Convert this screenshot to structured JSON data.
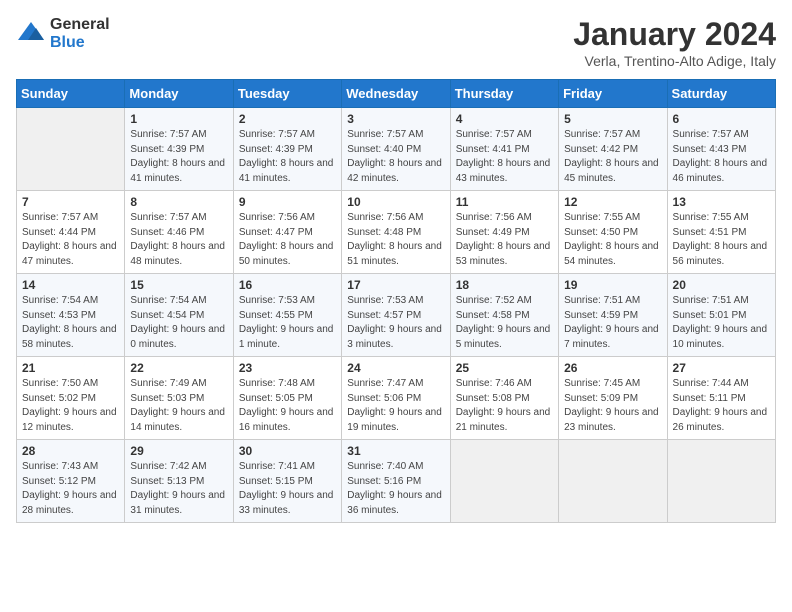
{
  "header": {
    "logo_line1": "General",
    "logo_line2": "Blue",
    "month": "January 2024",
    "location": "Verla, Trentino-Alto Adige, Italy"
  },
  "days_of_week": [
    "Sunday",
    "Monday",
    "Tuesday",
    "Wednesday",
    "Thursday",
    "Friday",
    "Saturday"
  ],
  "weeks": [
    [
      {
        "num": "",
        "sunrise": "",
        "sunset": "",
        "daylight": ""
      },
      {
        "num": "1",
        "sunrise": "Sunrise: 7:57 AM",
        "sunset": "Sunset: 4:39 PM",
        "daylight": "Daylight: 8 hours and 41 minutes."
      },
      {
        "num": "2",
        "sunrise": "Sunrise: 7:57 AM",
        "sunset": "Sunset: 4:39 PM",
        "daylight": "Daylight: 8 hours and 41 minutes."
      },
      {
        "num": "3",
        "sunrise": "Sunrise: 7:57 AM",
        "sunset": "Sunset: 4:40 PM",
        "daylight": "Daylight: 8 hours and 42 minutes."
      },
      {
        "num": "4",
        "sunrise": "Sunrise: 7:57 AM",
        "sunset": "Sunset: 4:41 PM",
        "daylight": "Daylight: 8 hours and 43 minutes."
      },
      {
        "num": "5",
        "sunrise": "Sunrise: 7:57 AM",
        "sunset": "Sunset: 4:42 PM",
        "daylight": "Daylight: 8 hours and 45 minutes."
      },
      {
        "num": "6",
        "sunrise": "Sunrise: 7:57 AM",
        "sunset": "Sunset: 4:43 PM",
        "daylight": "Daylight: 8 hours and 46 minutes."
      }
    ],
    [
      {
        "num": "7",
        "sunrise": "Sunrise: 7:57 AM",
        "sunset": "Sunset: 4:44 PM",
        "daylight": "Daylight: 8 hours and 47 minutes."
      },
      {
        "num": "8",
        "sunrise": "Sunrise: 7:57 AM",
        "sunset": "Sunset: 4:46 PM",
        "daylight": "Daylight: 8 hours and 48 minutes."
      },
      {
        "num": "9",
        "sunrise": "Sunrise: 7:56 AM",
        "sunset": "Sunset: 4:47 PM",
        "daylight": "Daylight: 8 hours and 50 minutes."
      },
      {
        "num": "10",
        "sunrise": "Sunrise: 7:56 AM",
        "sunset": "Sunset: 4:48 PM",
        "daylight": "Daylight: 8 hours and 51 minutes."
      },
      {
        "num": "11",
        "sunrise": "Sunrise: 7:56 AM",
        "sunset": "Sunset: 4:49 PM",
        "daylight": "Daylight: 8 hours and 53 minutes."
      },
      {
        "num": "12",
        "sunrise": "Sunrise: 7:55 AM",
        "sunset": "Sunset: 4:50 PM",
        "daylight": "Daylight: 8 hours and 54 minutes."
      },
      {
        "num": "13",
        "sunrise": "Sunrise: 7:55 AM",
        "sunset": "Sunset: 4:51 PM",
        "daylight": "Daylight: 8 hours and 56 minutes."
      }
    ],
    [
      {
        "num": "14",
        "sunrise": "Sunrise: 7:54 AM",
        "sunset": "Sunset: 4:53 PM",
        "daylight": "Daylight: 8 hours and 58 minutes."
      },
      {
        "num": "15",
        "sunrise": "Sunrise: 7:54 AM",
        "sunset": "Sunset: 4:54 PM",
        "daylight": "Daylight: 9 hours and 0 minutes."
      },
      {
        "num": "16",
        "sunrise": "Sunrise: 7:53 AM",
        "sunset": "Sunset: 4:55 PM",
        "daylight": "Daylight: 9 hours and 1 minute."
      },
      {
        "num": "17",
        "sunrise": "Sunrise: 7:53 AM",
        "sunset": "Sunset: 4:57 PM",
        "daylight": "Daylight: 9 hours and 3 minutes."
      },
      {
        "num": "18",
        "sunrise": "Sunrise: 7:52 AM",
        "sunset": "Sunset: 4:58 PM",
        "daylight": "Daylight: 9 hours and 5 minutes."
      },
      {
        "num": "19",
        "sunrise": "Sunrise: 7:51 AM",
        "sunset": "Sunset: 4:59 PM",
        "daylight": "Daylight: 9 hours and 7 minutes."
      },
      {
        "num": "20",
        "sunrise": "Sunrise: 7:51 AM",
        "sunset": "Sunset: 5:01 PM",
        "daylight": "Daylight: 9 hours and 10 minutes."
      }
    ],
    [
      {
        "num": "21",
        "sunrise": "Sunrise: 7:50 AM",
        "sunset": "Sunset: 5:02 PM",
        "daylight": "Daylight: 9 hours and 12 minutes."
      },
      {
        "num": "22",
        "sunrise": "Sunrise: 7:49 AM",
        "sunset": "Sunset: 5:03 PM",
        "daylight": "Daylight: 9 hours and 14 minutes."
      },
      {
        "num": "23",
        "sunrise": "Sunrise: 7:48 AM",
        "sunset": "Sunset: 5:05 PM",
        "daylight": "Daylight: 9 hours and 16 minutes."
      },
      {
        "num": "24",
        "sunrise": "Sunrise: 7:47 AM",
        "sunset": "Sunset: 5:06 PM",
        "daylight": "Daylight: 9 hours and 19 minutes."
      },
      {
        "num": "25",
        "sunrise": "Sunrise: 7:46 AM",
        "sunset": "Sunset: 5:08 PM",
        "daylight": "Daylight: 9 hours and 21 minutes."
      },
      {
        "num": "26",
        "sunrise": "Sunrise: 7:45 AM",
        "sunset": "Sunset: 5:09 PM",
        "daylight": "Daylight: 9 hours and 23 minutes."
      },
      {
        "num": "27",
        "sunrise": "Sunrise: 7:44 AM",
        "sunset": "Sunset: 5:11 PM",
        "daylight": "Daylight: 9 hours and 26 minutes."
      }
    ],
    [
      {
        "num": "28",
        "sunrise": "Sunrise: 7:43 AM",
        "sunset": "Sunset: 5:12 PM",
        "daylight": "Daylight: 9 hours and 28 minutes."
      },
      {
        "num": "29",
        "sunrise": "Sunrise: 7:42 AM",
        "sunset": "Sunset: 5:13 PM",
        "daylight": "Daylight: 9 hours and 31 minutes."
      },
      {
        "num": "30",
        "sunrise": "Sunrise: 7:41 AM",
        "sunset": "Sunset: 5:15 PM",
        "daylight": "Daylight: 9 hours and 33 minutes."
      },
      {
        "num": "31",
        "sunrise": "Sunrise: 7:40 AM",
        "sunset": "Sunset: 5:16 PM",
        "daylight": "Daylight: 9 hours and 36 minutes."
      },
      {
        "num": "",
        "sunrise": "",
        "sunset": "",
        "daylight": ""
      },
      {
        "num": "",
        "sunrise": "",
        "sunset": "",
        "daylight": ""
      },
      {
        "num": "",
        "sunrise": "",
        "sunset": "",
        "daylight": ""
      }
    ]
  ]
}
